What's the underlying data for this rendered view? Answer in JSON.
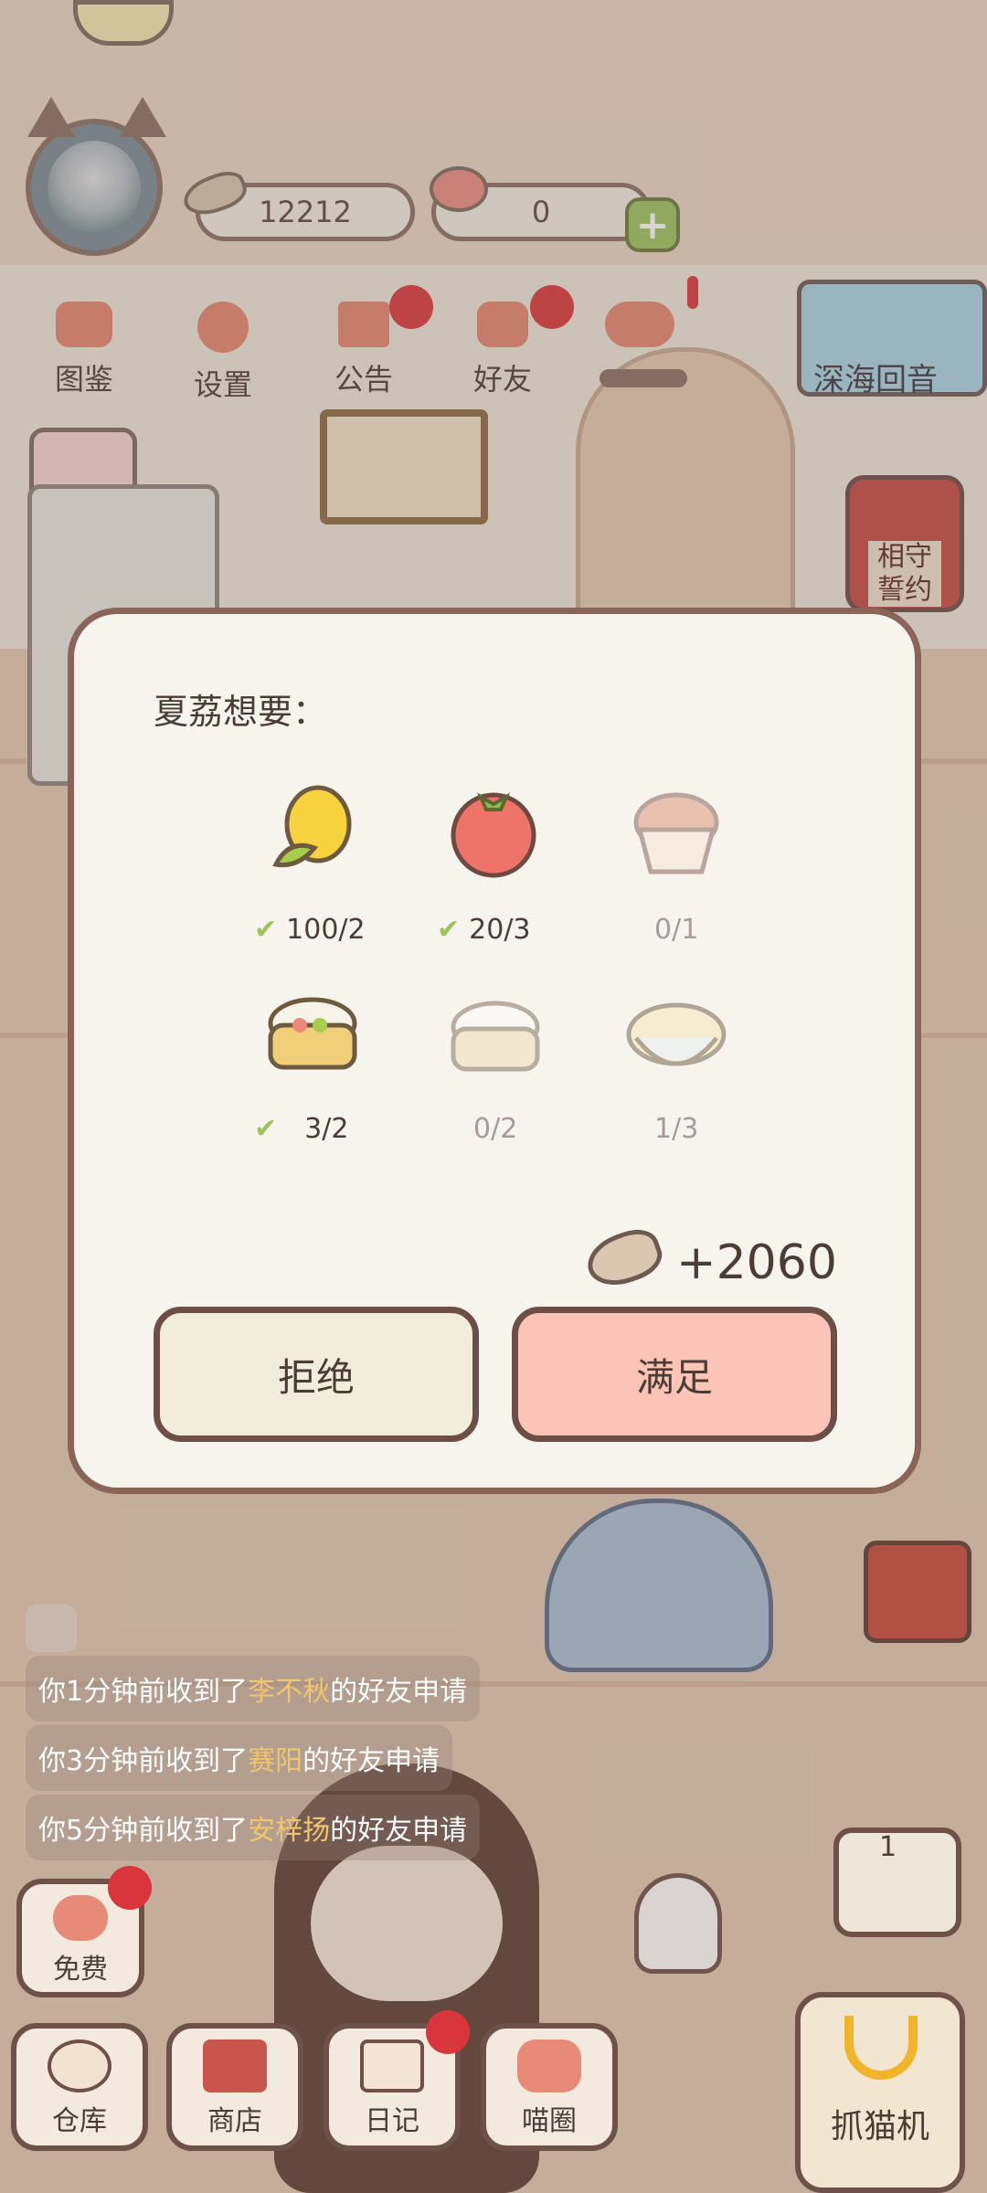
{
  "header": {
    "fish_count": "12212",
    "heart_count": "0",
    "plus_label": "+"
  },
  "menu": [
    {
      "label": "图鉴",
      "icon": "cat-book-icon"
    },
    {
      "label": "设置",
      "icon": "gear-icon"
    },
    {
      "label": "公告",
      "icon": "gift-icon"
    },
    {
      "label": "好友",
      "icon": "friends-icon"
    },
    {
      "label": "",
      "icon": "hearts-icon"
    }
  ],
  "banner": {
    "label": "深海回音"
  },
  "side_card": {
    "label": "相守誓约"
  },
  "dialog": {
    "title": "夏荔想要：",
    "items": [
      {
        "name": "corn",
        "count": "100/2",
        "done": true
      },
      {
        "name": "tomato",
        "count": "20/3",
        "done": true
      },
      {
        "name": "muffin",
        "count": "0/1",
        "done": false
      },
      {
        "name": "dim-sum",
        "count": "3/2",
        "done": true
      },
      {
        "name": "bun",
        "count": "0/2",
        "done": false
      },
      {
        "name": "noodles",
        "count": "1/3",
        "done": false
      }
    ],
    "check_mark": "✔",
    "reward": "+2060",
    "reject_label": "拒绝",
    "accept_label": "满足"
  },
  "notifications": [
    {
      "prefix": "你1分钟前收到了",
      "name": "李不秋",
      "suffix": "的好友申请"
    },
    {
      "prefix": "你3分钟前收到了",
      "name": "赛阳",
      "suffix": "的好友申请"
    },
    {
      "prefix": "你5分钟前收到了",
      "name": "安梓扬",
      "suffix": "的好友申请"
    }
  ],
  "bottom": {
    "free": "免费",
    "warehouse": "仓库",
    "shop": "商店",
    "diary": "日记",
    "circle": "喵圈",
    "claw": "抓猫机",
    "slot_count": "1"
  },
  "colors": {
    "accept": "#fbc4b6",
    "reject": "#f2ecdc",
    "check": "#9bc35a",
    "badge": "#d8363c"
  }
}
